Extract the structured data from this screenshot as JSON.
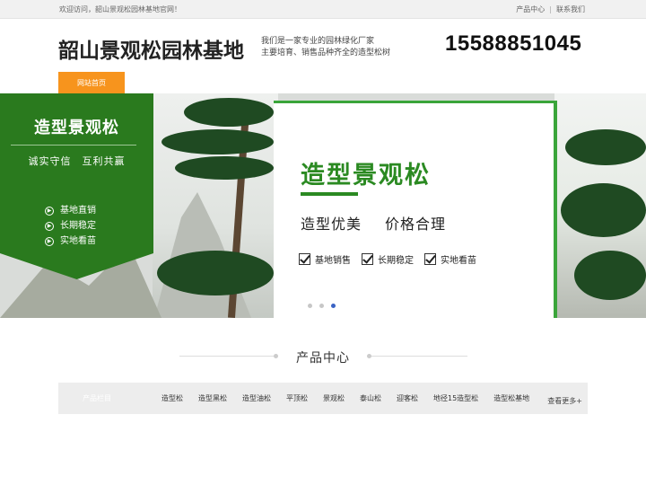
{
  "topbar": {
    "welcome": "欢迎访问，韶山景观松园林基地官网！",
    "links": [
      "产品中心",
      "联系我们"
    ],
    "separator": "|"
  },
  "header": {
    "title": "韶山景观松园林基地",
    "slogan_lines": [
      "我们是一家专业的园林绿化厂家",
      "主要培育、销售品种齐全的造型松树"
    ],
    "phone": "15588851045"
  },
  "nav": {
    "home_label": "网站首页"
  },
  "banner": {
    "panel_title": "造型景观松",
    "panel_motto": "诚实守信　互利共赢",
    "panel_items": [
      "基地直销",
      "长期稳定",
      "实地看苗"
    ],
    "card_title": "造型景观松",
    "card_slogans": [
      "造型优美",
      "价格合理"
    ],
    "card_checks": [
      "基地销售",
      "长期稳定",
      "实地看苗"
    ],
    "slide_count": 3,
    "active_slide": 3,
    "colors": {
      "panel_green": "#2a7a1e",
      "accent_green": "#2b8a22"
    }
  },
  "products": {
    "section_title": "产品中心",
    "category_label": "产品栏目",
    "categories": [
      "造型松",
      "造型黑松",
      "造型油松",
      "平顶松",
      "景观松",
      "泰山松",
      "迎客松",
      "地径15造型松",
      "造型松基地"
    ],
    "more_label": "查看更多+"
  },
  "theme": {
    "nav_orange": "#f7941d",
    "active_dot": "#3a63c4"
  }
}
